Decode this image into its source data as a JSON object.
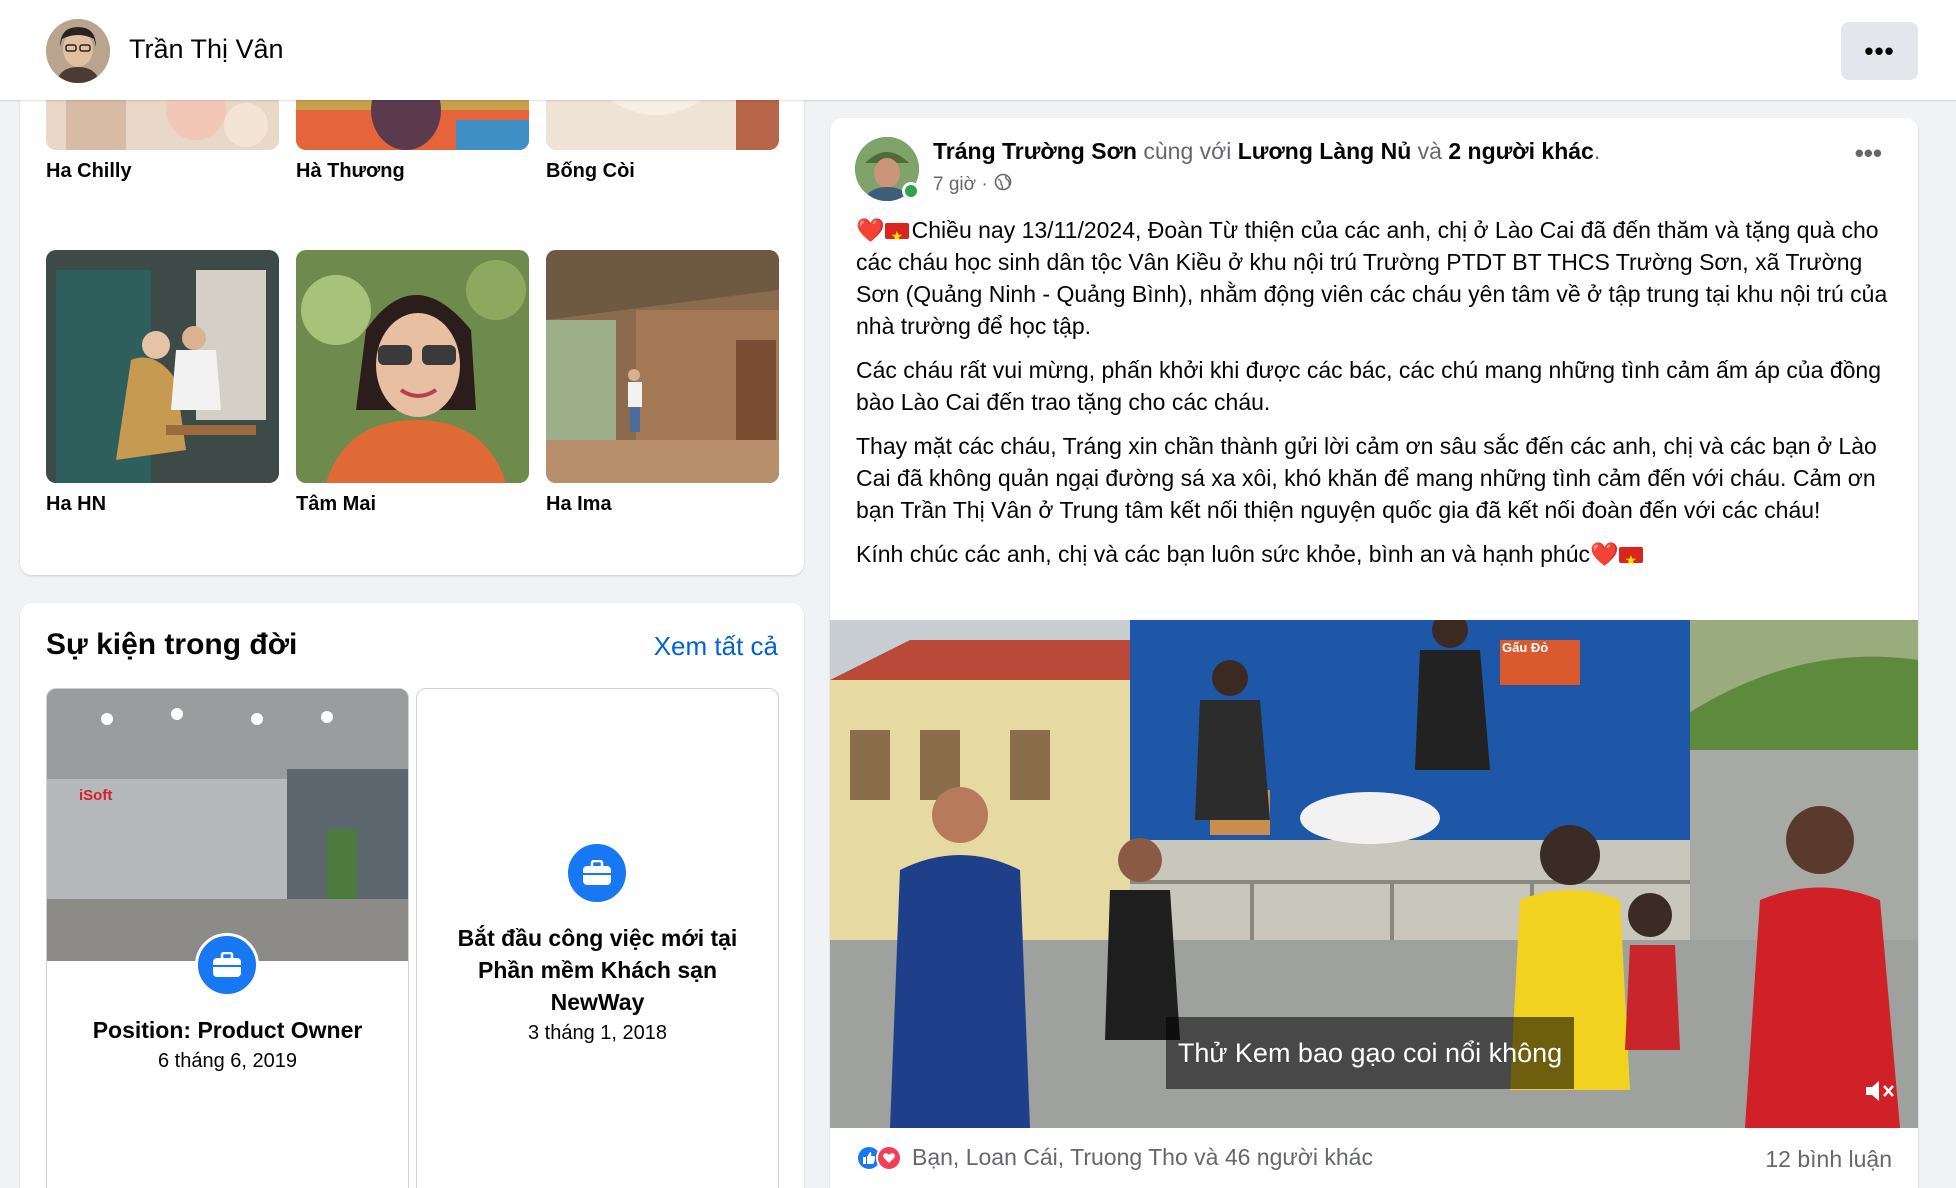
{
  "profile": {
    "name": "Trần Thị Vân",
    "menu_label": "•••"
  },
  "friends": [
    {
      "name": "Ha Chilly"
    },
    {
      "name": "Hà Thương"
    },
    {
      "name": "Bống Còi"
    },
    {
      "name": "Ha HN"
    },
    {
      "name": "Tâm Mai"
    },
    {
      "name": "Ha Ima"
    }
  ],
  "events": {
    "title": "Sự kiện trong đời",
    "see_all": "Xem tất cả",
    "items": [
      {
        "title": "Position: Product Owner",
        "date": "6 tháng 6, 2019",
        "photo_sign": "iSoft"
      },
      {
        "title": "Bắt đầu công việc mới tại Phần mềm Khách sạn NewWay",
        "date": "3 tháng 1, 2018"
      }
    ]
  },
  "post": {
    "author": "Tráng Trường Sơn",
    "with_word": "cùng với",
    "tagged": "Lương Làng Nủ",
    "and_word": "và",
    "others": "2 người khác",
    "time": "7 giờ ·",
    "more_label": "•••",
    "paragraphs": [
      "Chiều nay 13/11/2024, Đoàn Từ thiện của  các anh, chị ở Lào Cai đã đến thăm và tặng quà cho các cháu học sinh dân tộc Vân Kiều ở khu nội trú Trường PTDT BT THCS Trường Sơn, xã Trường Sơn (Quảng Ninh - Quảng Bình), nhằm động viên các cháu yên tâm về ở tập trung tại khu nội trú của nhà trường để  học tập.",
      "Các cháu rất vui mừng, phấn khởi khi được các bác, các chú mang những tình cảm ấm áp của đồng bào Lào Cai đến trao tặng cho các cháu.",
      "Thay mặt các cháu, Tráng xin chần thành gửi lời cảm ơn sâu sắc đến các anh, chị và các bạn ở Lào Cai đã không quản ngại đường sá xa xôi, khó khăn để mang những tình cảm đến với cháu. Cảm ơn bạn Trần Thị Vân ở Trung tâm kết nối thiện nguyện quốc gia đã kết nối đoàn đến với các cháu!",
      "Kính chúc các anh, chị và các bạn luôn sức khỏe, bình an và hạnh phúc"
    ],
    "video_caption": "Thử Kem bao gạo coi nổi không",
    "box_label": "Gấu Đỏ",
    "reactions_text": "Bạn, Loan Cái, Truong Tho và 46 người khác",
    "comments_text": "12 bình luận"
  },
  "colors": {
    "accent": "#1877f2",
    "link": "#0064d1",
    "online": "#31a24c",
    "background": "#f0f2f5"
  }
}
